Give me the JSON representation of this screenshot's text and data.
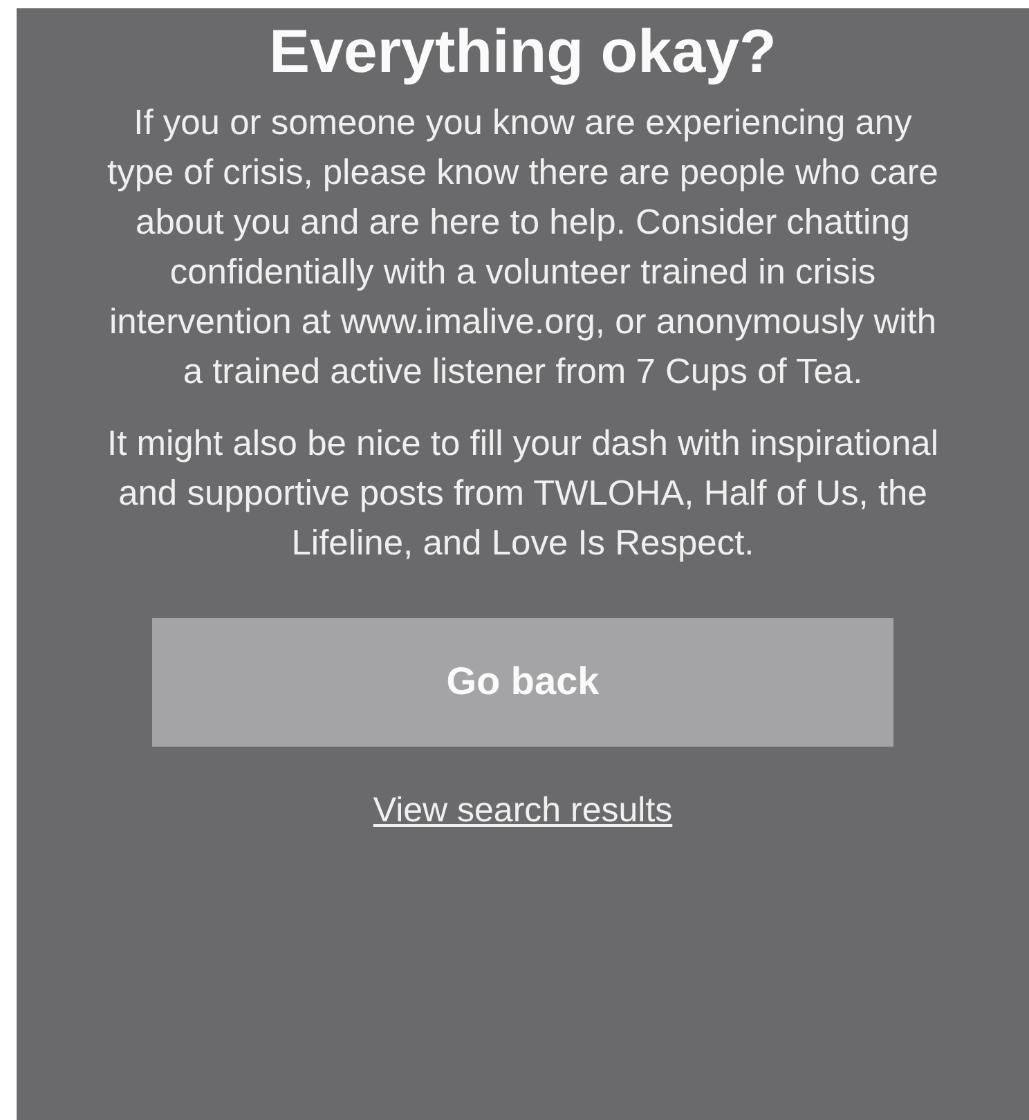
{
  "title": "Everything okay?",
  "paragraphs": [
    "If you or someone you know are experiencing any type of crisis, please know there are people who care about you and are here to help. Consider chatting confidentially with a volunteer trained in crisis intervention at www.imalive.org, or anonymously with a trained active listener from 7 Cups of Tea.",
    "It might also be nice to fill your dash with inspirational and supportive posts from TWLOHA, Half of Us, the Lifeline, and Love Is Respect."
  ],
  "button": "Go back",
  "link": "View search results"
}
